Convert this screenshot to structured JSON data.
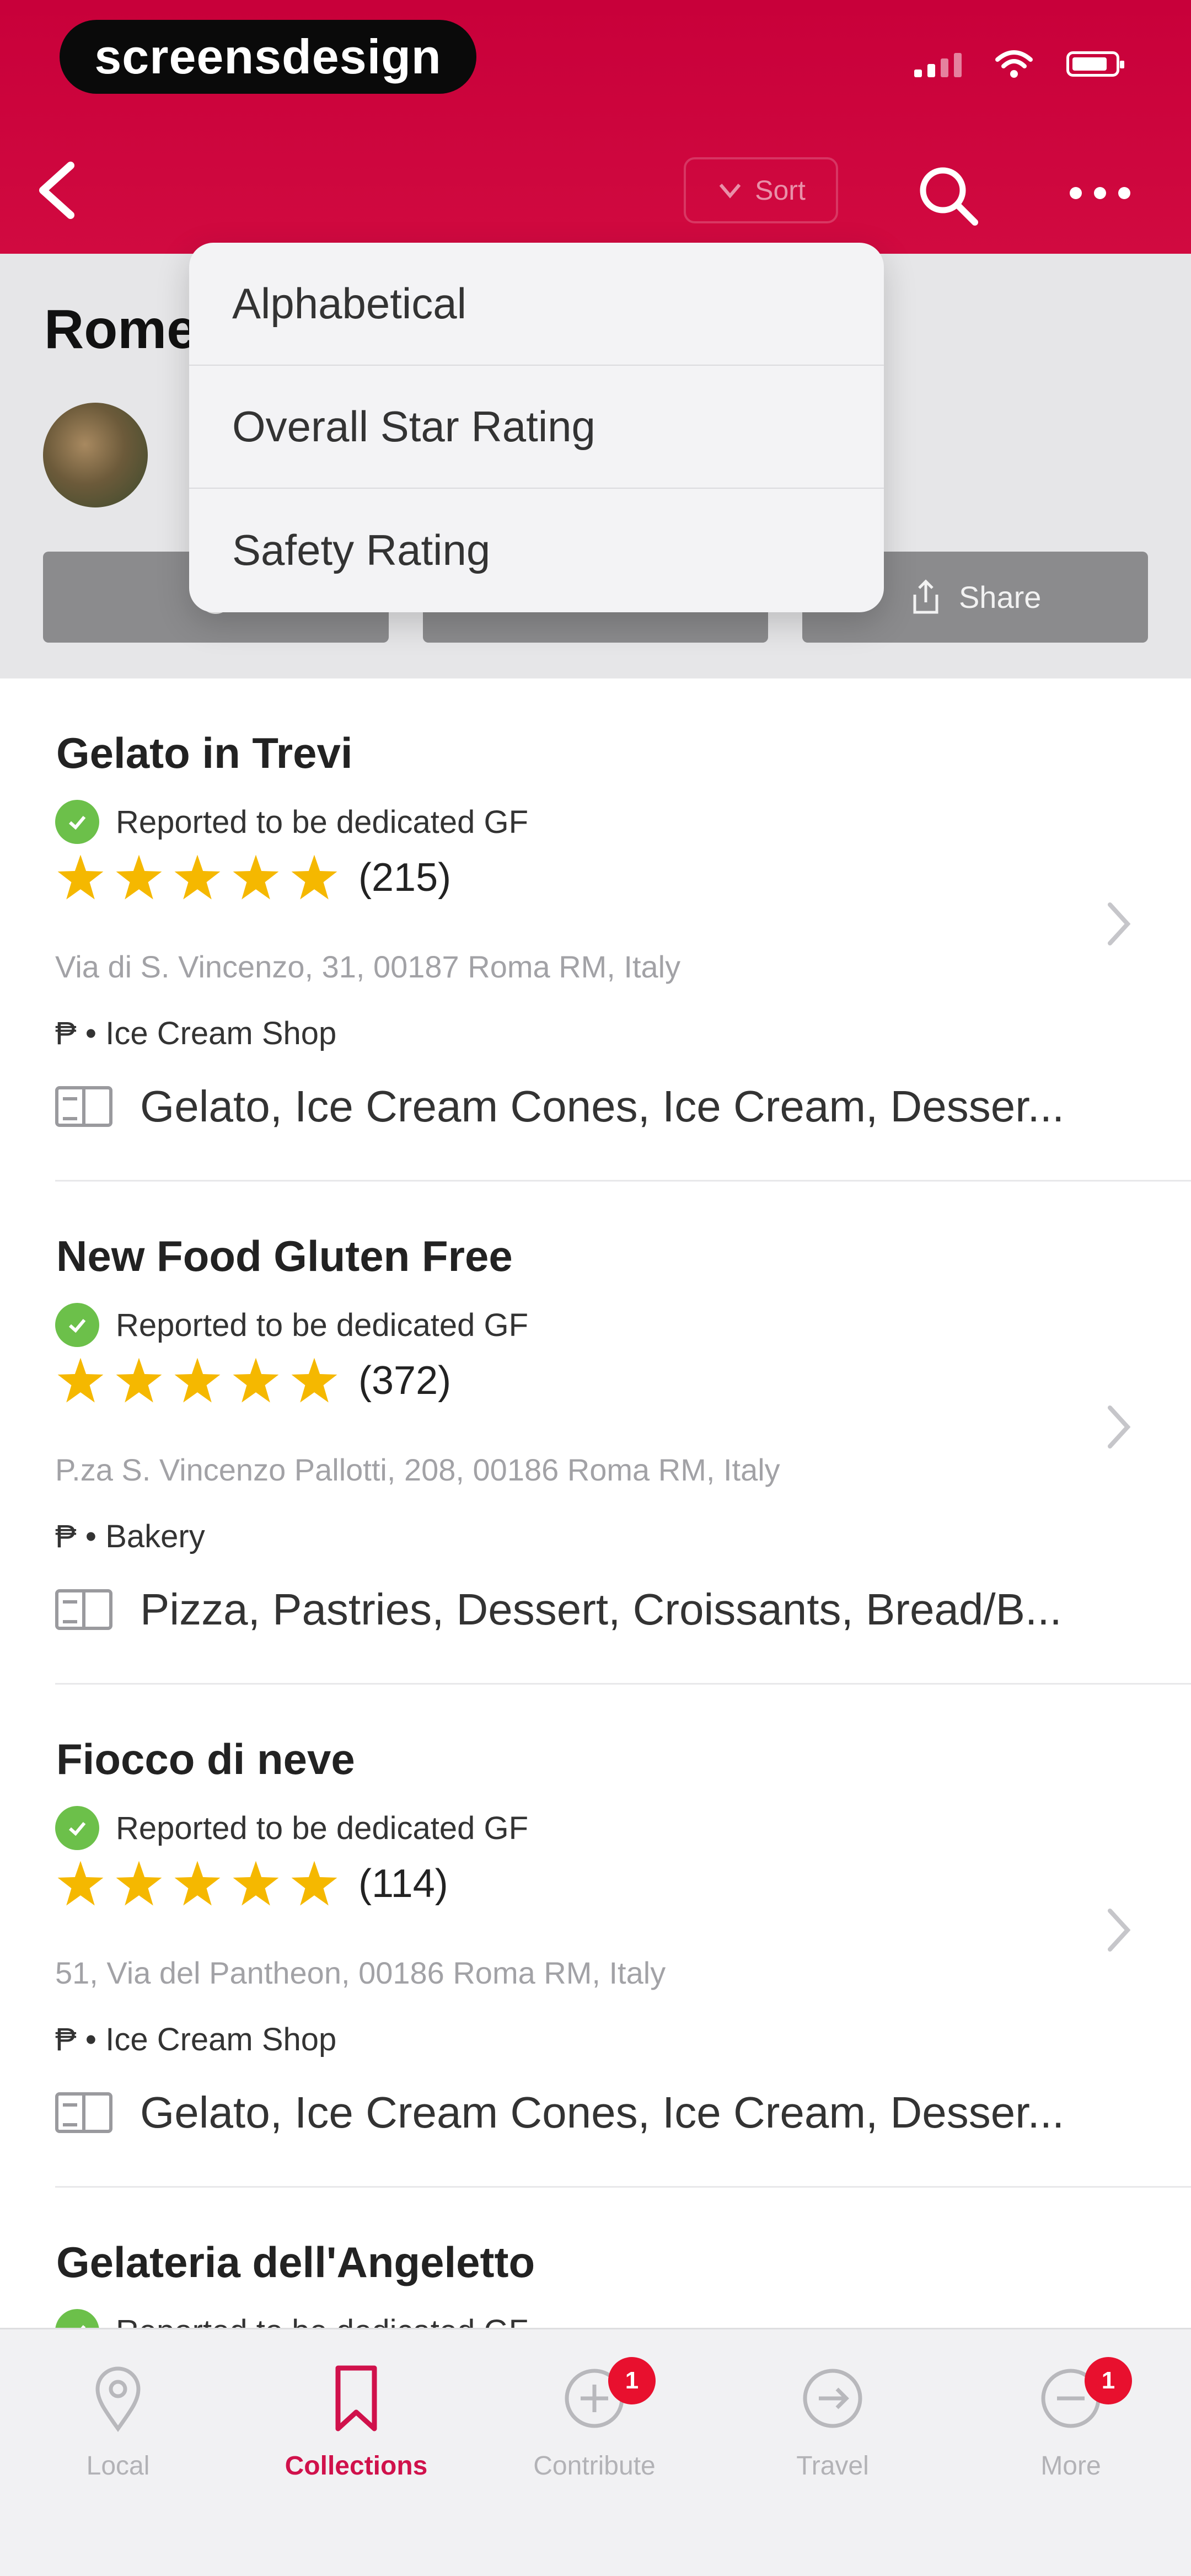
{
  "status_bar": {
    "brand": "screensdesign"
  },
  "nav": {
    "sort_label": "Sort",
    "icons": [
      "back-icon",
      "sort-icon",
      "search-icon",
      "more-icon"
    ]
  },
  "sort_menu": {
    "options": [
      "Alphabetical",
      "Overall Star Rating",
      "Safety Rating"
    ]
  },
  "collection": {
    "title": "Rome",
    "actions": [
      "Share"
    ]
  },
  "places": [
    {
      "name": "Gelato in Trevi",
      "gf_status": "Reported to be dedicated GF",
      "stars": 5,
      "review_count": "(215)",
      "address": "Via di S. Vincenzo, 31, 00187 Roma RM, Italy",
      "type": "₱ • Ice Cream Shop",
      "menu": "Gelato, Ice Cream Cones, Ice Cream, Desser..."
    },
    {
      "name": "New Food Gluten Free",
      "gf_status": "Reported to be dedicated GF",
      "stars": 5,
      "review_count": "(372)",
      "address": "P.za S. Vincenzo Pallotti, 208, 00186 Roma RM, Italy",
      "type": "₱ • Bakery",
      "menu": "Pizza, Pastries, Dessert, Croissants, Bread/B..."
    },
    {
      "name": "Fiocco di neve",
      "gf_status": "Reported to be dedicated GF",
      "stars": 5,
      "review_count": "(114)",
      "address": "51, Via del Pantheon, 00186 Roma RM, Italy",
      "type": "₱ • Ice Cream Shop",
      "menu": "Gelato, Ice Cream Cones, Ice Cream, Desser..."
    },
    {
      "name": "Gelateria dell'Angeletto",
      "gf_status": "Reported to be dedicated GF"
    }
  ],
  "tabbar": {
    "tabs": [
      {
        "label": "Local",
        "icon": "location-pin-icon"
      },
      {
        "label": "Collections",
        "icon": "bookmark-icon",
        "active": true
      },
      {
        "label": "Contribute",
        "icon": "plus-circle-icon",
        "badge": "1"
      },
      {
        "label": "Travel",
        "icon": "travel-icon"
      },
      {
        "label": "More",
        "icon": "more-circle-icon",
        "badge": "1"
      }
    ]
  },
  "colors": {
    "brand": "#d0114b",
    "star": "#f5b800",
    "gf_check": "#6cc04a",
    "badge": "#e8102e"
  }
}
